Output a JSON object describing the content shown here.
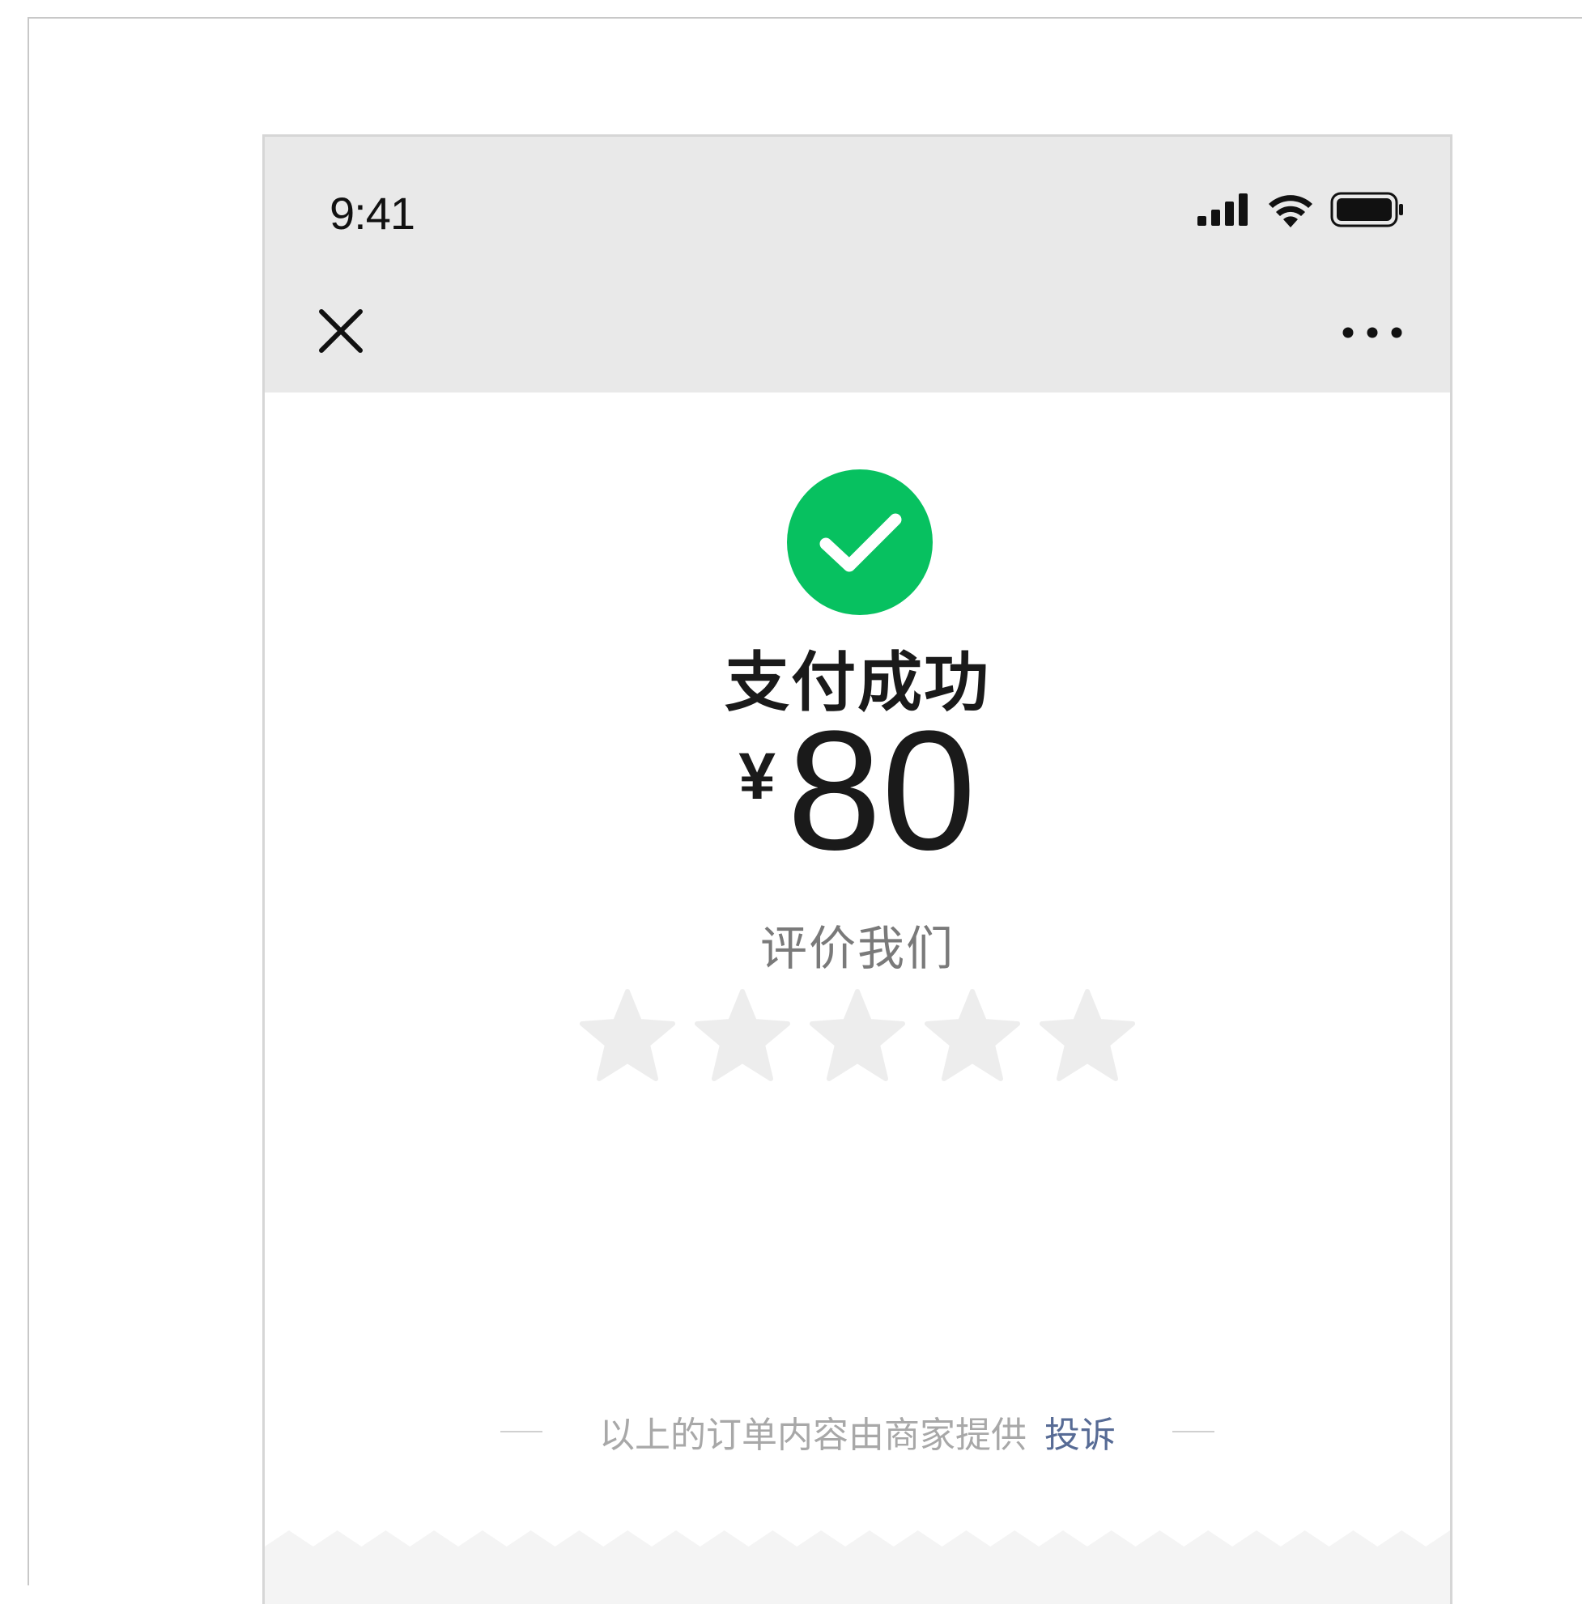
{
  "status_bar": {
    "time": "9:41",
    "icons": [
      "signal-icon",
      "wifi-icon",
      "battery-icon"
    ]
  },
  "nav": {
    "close_icon": "close-icon",
    "more_icon": "more-icon"
  },
  "payment": {
    "status_icon": "success-check-icon",
    "title": "支付成功",
    "currency": "¥",
    "amount": "80"
  },
  "rating": {
    "label": "评价我们",
    "max_stars": 5,
    "selected": 0
  },
  "footer": {
    "note": "以上的订单内容由商家提供",
    "complain_label": "投诉"
  },
  "colors": {
    "topbar": "#e9e9e9",
    "success_green": "#07c160",
    "star_inactive": "#ededed",
    "link_blue": "#576b95",
    "text_primary": "#1a1a1a",
    "text_secondary": "#7a7a7a",
    "text_hint": "#a8a8a8"
  }
}
